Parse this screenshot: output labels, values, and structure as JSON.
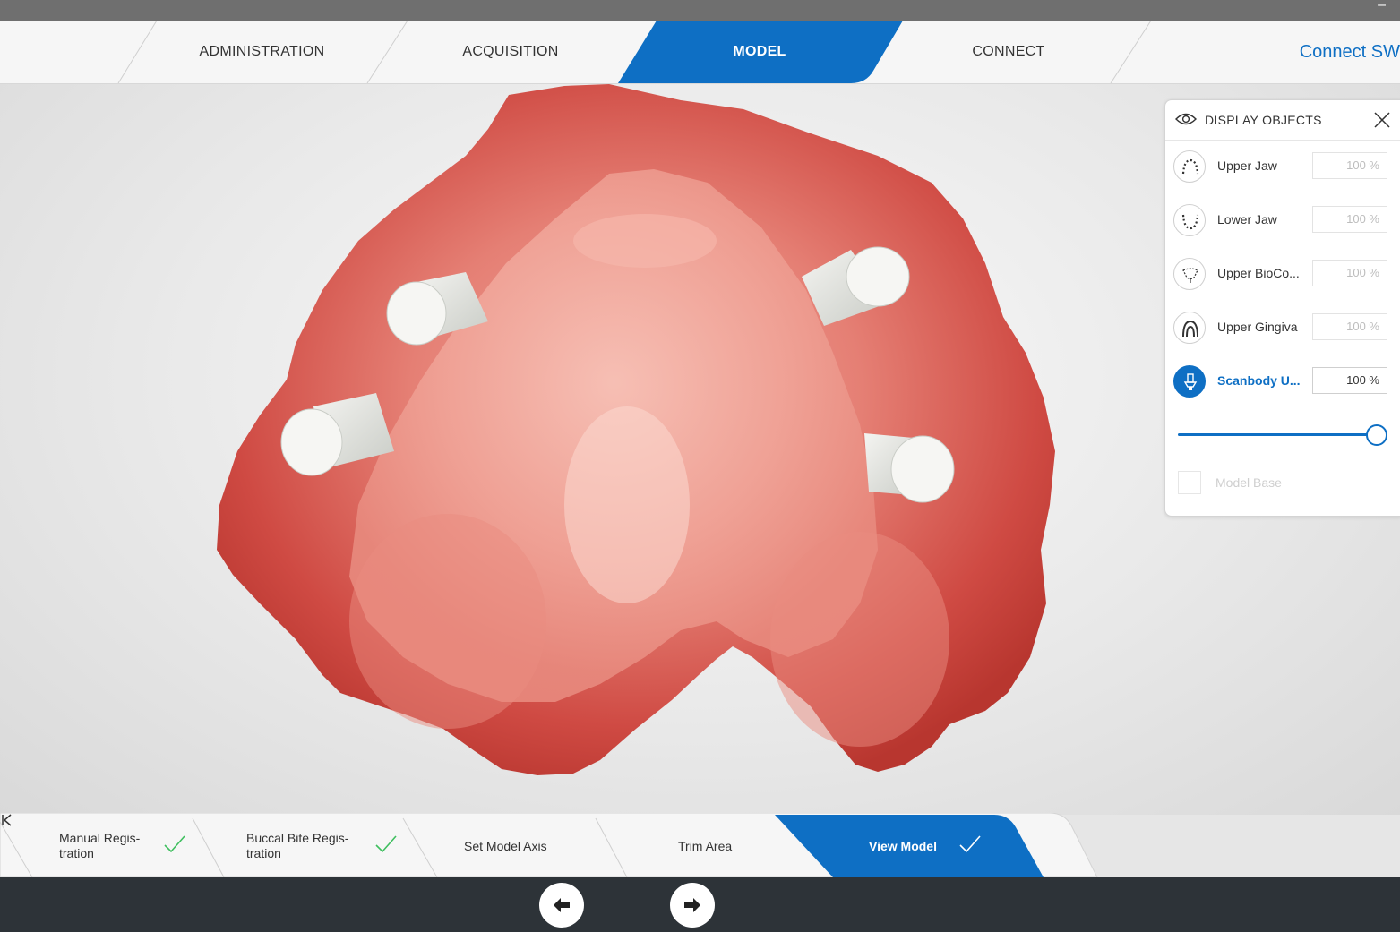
{
  "window": {
    "minimize_glyph": "–"
  },
  "top_nav": {
    "tabs": [
      {
        "label": "ADMINISTRATION",
        "active": false
      },
      {
        "label": "ACQUISITION",
        "active": false
      },
      {
        "label": "MODEL",
        "active": true
      },
      {
        "label": "CONNECT",
        "active": false
      }
    ],
    "brand": "Connect SW"
  },
  "display_objects": {
    "title": "DISPLAY OBJECTS",
    "items": [
      {
        "label": "Upper Jaw",
        "opacity": "100 %",
        "icon": "upper-jaw-icon",
        "active": false
      },
      {
        "label": "Lower Jaw",
        "opacity": "100 %",
        "icon": "lower-jaw-icon",
        "active": false
      },
      {
        "label": "Upper BioCo...",
        "opacity": "100 %",
        "icon": "upper-biocopy-icon",
        "active": false
      },
      {
        "label": "Upper Gingiva",
        "opacity": "100 %",
        "icon": "upper-gingiva-icon",
        "active": false
      },
      {
        "label": "Scanbody U...",
        "opacity": "100 %",
        "icon": "scanbody-icon",
        "active": true
      }
    ],
    "slider_value": 1.0,
    "model_base_label": "Model Base"
  },
  "workflow": {
    "steps": [
      {
        "label_line1": "Manual Regis-",
        "label_line2": "tration",
        "done": true
      },
      {
        "label_line1": "Buccal Bite Regis-",
        "label_line2": "tration",
        "done": true
      },
      {
        "label_line1": "Set Model Axis",
        "label_line2": "",
        "done": false
      },
      {
        "label_line1": "Trim Area",
        "label_line2": "",
        "done": false
      },
      {
        "label_line1": "View Model",
        "label_line2": "",
        "done": true,
        "active": true
      }
    ]
  },
  "colors": {
    "accent": "#0e6fc4",
    "check": "#3fbf5f",
    "bottom_bar": "#2d3338",
    "gum": "#d9524a"
  }
}
